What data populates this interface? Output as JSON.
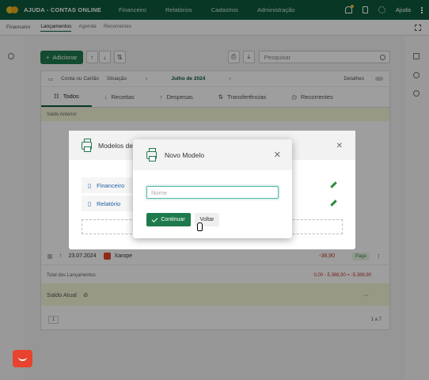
{
  "topbar": {
    "brand": "AJUDA - CONTAS ONLINE",
    "nav": [
      "Financeiro",
      "Relatórios",
      "Cadastros",
      "Administração"
    ],
    "help": "Ajuda"
  },
  "breadcrumb": {
    "root": "Financeiro",
    "tabs": [
      "Lançamentos",
      "Agenda",
      "Recorrentes"
    ]
  },
  "toolbar": {
    "add_label": "Adicionar",
    "search_placeholder": "Pesquisar"
  },
  "filters": {
    "account": "Conta ou Cartão",
    "status": "Situação",
    "month": "Julho de 2024",
    "details": "Detalhes"
  },
  "tabs": [
    "Todos",
    "Receitas",
    "Despesas",
    "Transferências",
    "Recorrentes"
  ],
  "ledger": {
    "previous_balance_label": "Saldo Anterior",
    "last_row": {
      "date": "23.07.2024",
      "description": "Xarope",
      "amount": "-38,90",
      "status": "Pago"
    },
    "totals_label": "Total dos Lançamentos",
    "totals_values": "0,00  -  5.388,90  =  -5.388,90",
    "current_balance_label": "Saldo Atual",
    "pagination": "1",
    "page_count": "1 a 7"
  },
  "models_dialog": {
    "title": "Modelos de",
    "items": [
      "Financeiro",
      "Relatório"
    ]
  },
  "new_model_dialog": {
    "title": "Novo Modelo",
    "name_placeholder": "Nome",
    "name_value": "",
    "continue_label": "Continuar",
    "back_label": "Voltar"
  },
  "colors": {
    "brand": "#0e5b3c",
    "primary_button": "#1e7a4c",
    "input_focus": "#58b8a8",
    "balance_row": "#f4f7d7"
  }
}
